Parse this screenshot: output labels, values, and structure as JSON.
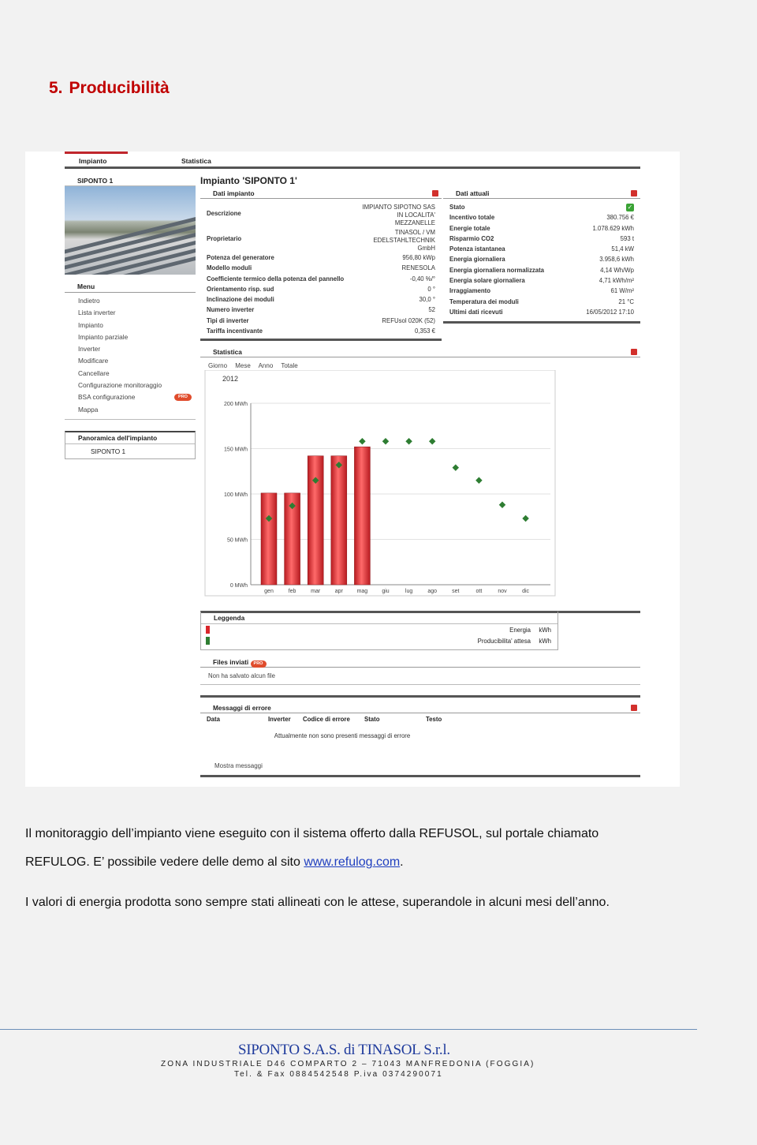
{
  "heading": {
    "number": "5.",
    "title": "Producibilità"
  },
  "portal": {
    "tabs": [
      "Impianto",
      "Statistica"
    ],
    "plant_name": "SIPONTO 1",
    "main_title": "Impianto 'SIPONTO 1'",
    "menu_title": "Menu",
    "menu_items": [
      "Indietro",
      "Lista inverter",
      "Impianto",
      "Impianto parziale",
      "Inverter",
      "Modificare",
      "Cancellare",
      "Configurazione monitoraggio",
      "BSA configurazione",
      "Mappa"
    ],
    "pro_label": "PRO",
    "overview_title": "Panoramica dell'impianto",
    "overview_item": "SIPONTO 1",
    "dati_impianto": {
      "title": "Dati impianto",
      "rows": [
        {
          "k": "Descrizione",
          "v": "IMPIANTO SIPOTNO SAS IN LOCALITA' MEZZANELLE"
        },
        {
          "k": "Proprietario",
          "v": "TINASOL / VM EDELSTAHLTECHNIK GmbH"
        },
        {
          "k": "Potenza del generatore",
          "v": "956,80 kWp"
        },
        {
          "k": "Modello moduli",
          "v": "RENESOLA"
        },
        {
          "k": "Coefficiente termico della potenza del pannello",
          "v": "-0,40 %/°"
        },
        {
          "k": "Orientamento risp. sud",
          "v": "0 °"
        },
        {
          "k": "Inclinazione dei moduli",
          "v": "30,0 °"
        },
        {
          "k": "Numero inverter",
          "v": "52"
        },
        {
          "k": "Tipi di inverter",
          "v": "REFUsol 020K (52)"
        },
        {
          "k": "Tariffa incentivante",
          "v": "0,353 €"
        }
      ]
    },
    "dati_attuali": {
      "title": "Dati attuali",
      "rows": [
        {
          "k": "Stato",
          "v": ""
        },
        {
          "k": "Incentivo totale",
          "v": "380.756 €"
        },
        {
          "k": "Energie totale",
          "v": "1.078.629 kWh"
        },
        {
          "k": "Risparmio CO2",
          "v": "593 t"
        },
        {
          "k": "Potenza istantanea",
          "v": "51,4 kW"
        },
        {
          "k": "Energia giornaliera",
          "v": "3.958,6 kWh"
        },
        {
          "k": "Energia giornaliera normalizzata",
          "v": "4,14 Wh/Wp"
        },
        {
          "k": "Energia solare giornaliera",
          "v": "4,71 kWh/m²"
        },
        {
          "k": "Irraggiamento",
          "v": "61 W/m²"
        },
        {
          "k": "Temperatura dei moduli",
          "v": "21 °C"
        },
        {
          "k": "Ultimi dati ricevuti",
          "v": "16/05/2012 17:10"
        }
      ]
    },
    "statistica": {
      "title": "Statistica",
      "tabs": [
        "Giorno",
        "Mese",
        "Anno",
        "Totale"
      ]
    },
    "legend": {
      "title": "Leggenda",
      "items": [
        {
          "label": "Energia",
          "unit": "kWh",
          "color": "#d9262b"
        },
        {
          "label": "Producibilita' attesa",
          "unit": "kWh",
          "color": "#2e7d32"
        }
      ]
    },
    "files": {
      "title": "Files inviati",
      "text": "Non ha salvato alcun file"
    },
    "errors": {
      "title": "Messaggi di errore",
      "cols": [
        "Data",
        "Inverter",
        "Codice di errore",
        "Stato",
        "Testo"
      ],
      "empty": "Attualmente non sono presenti messaggi di errore",
      "show": "Mostra messaggi"
    },
    "colors": {
      "accent": "#c0262c",
      "bar": "#d9262b",
      "marker": "#2e7d32"
    }
  },
  "chart_data": {
    "type": "bar",
    "title": "2012",
    "categories": [
      "gen",
      "feb",
      "mar",
      "apr",
      "mag",
      "giu",
      "lug",
      "ago",
      "set",
      "ott",
      "nov",
      "dic"
    ],
    "series": [
      {
        "name": "Energia",
        "values": [
          101,
          101,
          142,
          142,
          152,
          0,
          0,
          0,
          0,
          0,
          0,
          0
        ]
      },
      {
        "name": "Producibilita' attesa",
        "values": [
          73,
          87,
          115,
          132,
          158,
          158,
          158,
          158,
          129,
          115,
          88,
          73
        ]
      }
    ],
    "y_ticks": [
      "0 MWh",
      "50 MWh",
      "100 MWh",
      "150 MWh",
      "200 MWh"
    ],
    "ylim": [
      0,
      200
    ],
    "grid": true
  },
  "text": {
    "p1_line1": "Il monitoraggio dell’impianto viene eseguito con il sistema offerto dalla REFUSOL, sul portale chiamato",
    "p1_line2_pre": "REFULOG. E’ possibile vedere delle demo al sito ",
    "p1_link": "www.refulog.com",
    "p1_line2_post": ".",
    "p2": "I valori di energia prodotta sono sempre stati allineati con le attese, superandole in alcuni mesi dell’anno."
  },
  "footer": {
    "company": "SIPONTO S.A.S.  di TINASOL S.r.l.",
    "address": "ZONA INDUSTRIALE D46 COMPARTO 2 – 71043  MANFREDONIA (FOGGIA)",
    "tel": "Tel. & Fax  0884542548  P.iva 0374290071"
  }
}
